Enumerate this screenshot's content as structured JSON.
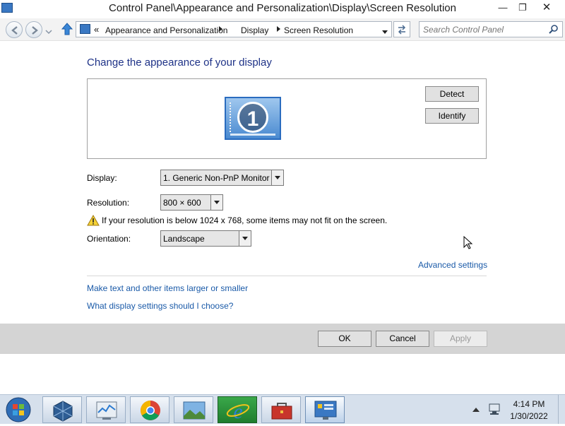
{
  "window": {
    "title": "Control Panel\\Appearance and Personalization\\Display\\Screen Resolution"
  },
  "nav": {
    "breadcrumbs": [
      "Appearance and Personalization",
      "Display",
      "Screen Resolution"
    ],
    "search_placeholder": "Search Control Panel"
  },
  "main": {
    "heading": "Change the appearance of your display",
    "monitor_number": "1",
    "detect_label": "Detect",
    "identify_label": "Identify",
    "display_label": "Display:",
    "display_value": "1. Generic Non-PnP Monitor",
    "resolution_label": "Resolution:",
    "resolution_value": "800 × 600",
    "warning_text": "If your resolution is below 1024 x 768, some items may not fit on the screen.",
    "orientation_label": "Orientation:",
    "orientation_value": "Landscape",
    "advanced_link": "Advanced settings",
    "link_text_size": "Make text and other items larger or smaller",
    "link_help": "What display settings should I choose?"
  },
  "buttons": {
    "ok": "OK",
    "cancel": "Cancel",
    "apply": "Apply"
  },
  "taskbar": {
    "items": [
      "start-orb",
      "virtualbox",
      "resource-monitor",
      "chrome",
      "photos",
      "internet-explorer",
      "toolbox",
      "control-panel"
    ],
    "clock_time": "4:14 PM",
    "clock_date": "1/30/2022"
  },
  "colors": {
    "heading": "#1e3287",
    "link": "#1a5aa8",
    "taskbar": "#d6e0ec",
    "button_strip": "#d4d4d4"
  }
}
